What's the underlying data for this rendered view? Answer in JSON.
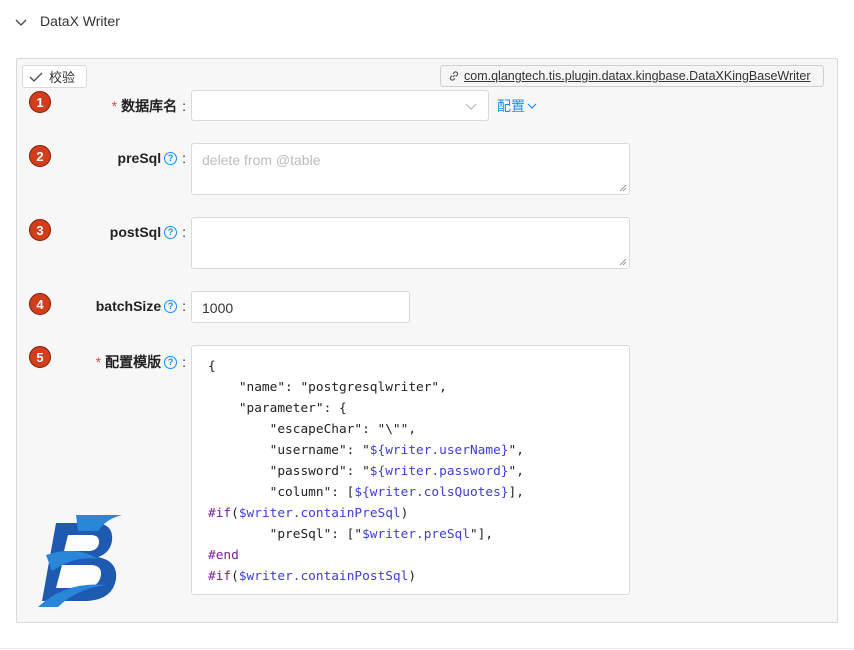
{
  "header": {
    "title": "DataX Writer"
  },
  "toolbar": {
    "verify_label": "校验",
    "plugin_class": "com.qlangtech.tis.plugin.datax.kingbase.DataXKingBaseWriter"
  },
  "form": {
    "fields": [
      {
        "badge": "1",
        "label": "数据库名",
        "required": true,
        "config_link": "配置",
        "value": ""
      },
      {
        "badge": "2",
        "label": "preSql",
        "placeholder": "delete from @table",
        "value": ""
      },
      {
        "badge": "3",
        "label": "postSql",
        "value": ""
      },
      {
        "badge": "4",
        "label": "batchSize",
        "value": "1000"
      },
      {
        "badge": "5",
        "label": "配置模版",
        "required": true
      }
    ],
    "colon": ":"
  },
  "template_lines": [
    "{",
    "    \"name\": \"postgresqlwriter\",",
    "    \"parameter\": {",
    "        \"escapeChar\": \"\\\"\",",
    "        \"username\": \"${writer.userName}\",",
    "        \"password\": \"${writer.password}\",",
    "        \"column\": [${writer.colsQuotes}],",
    "#if($writer.containPreSql)",
    "        \"preSql\": [\"$writer.preSql\"],",
    "#end",
    "#if($writer.containPostSql)"
  ],
  "icons": {
    "collapse": "chevron-down-icon",
    "verify": "check-icon",
    "plugin": "link-icon",
    "help": "question-circle-icon",
    "logo": "brand-logo"
  },
  "colors": {
    "accent": "#1a8cff",
    "badge": "#d23d1c",
    "required": "#e5484d"
  }
}
